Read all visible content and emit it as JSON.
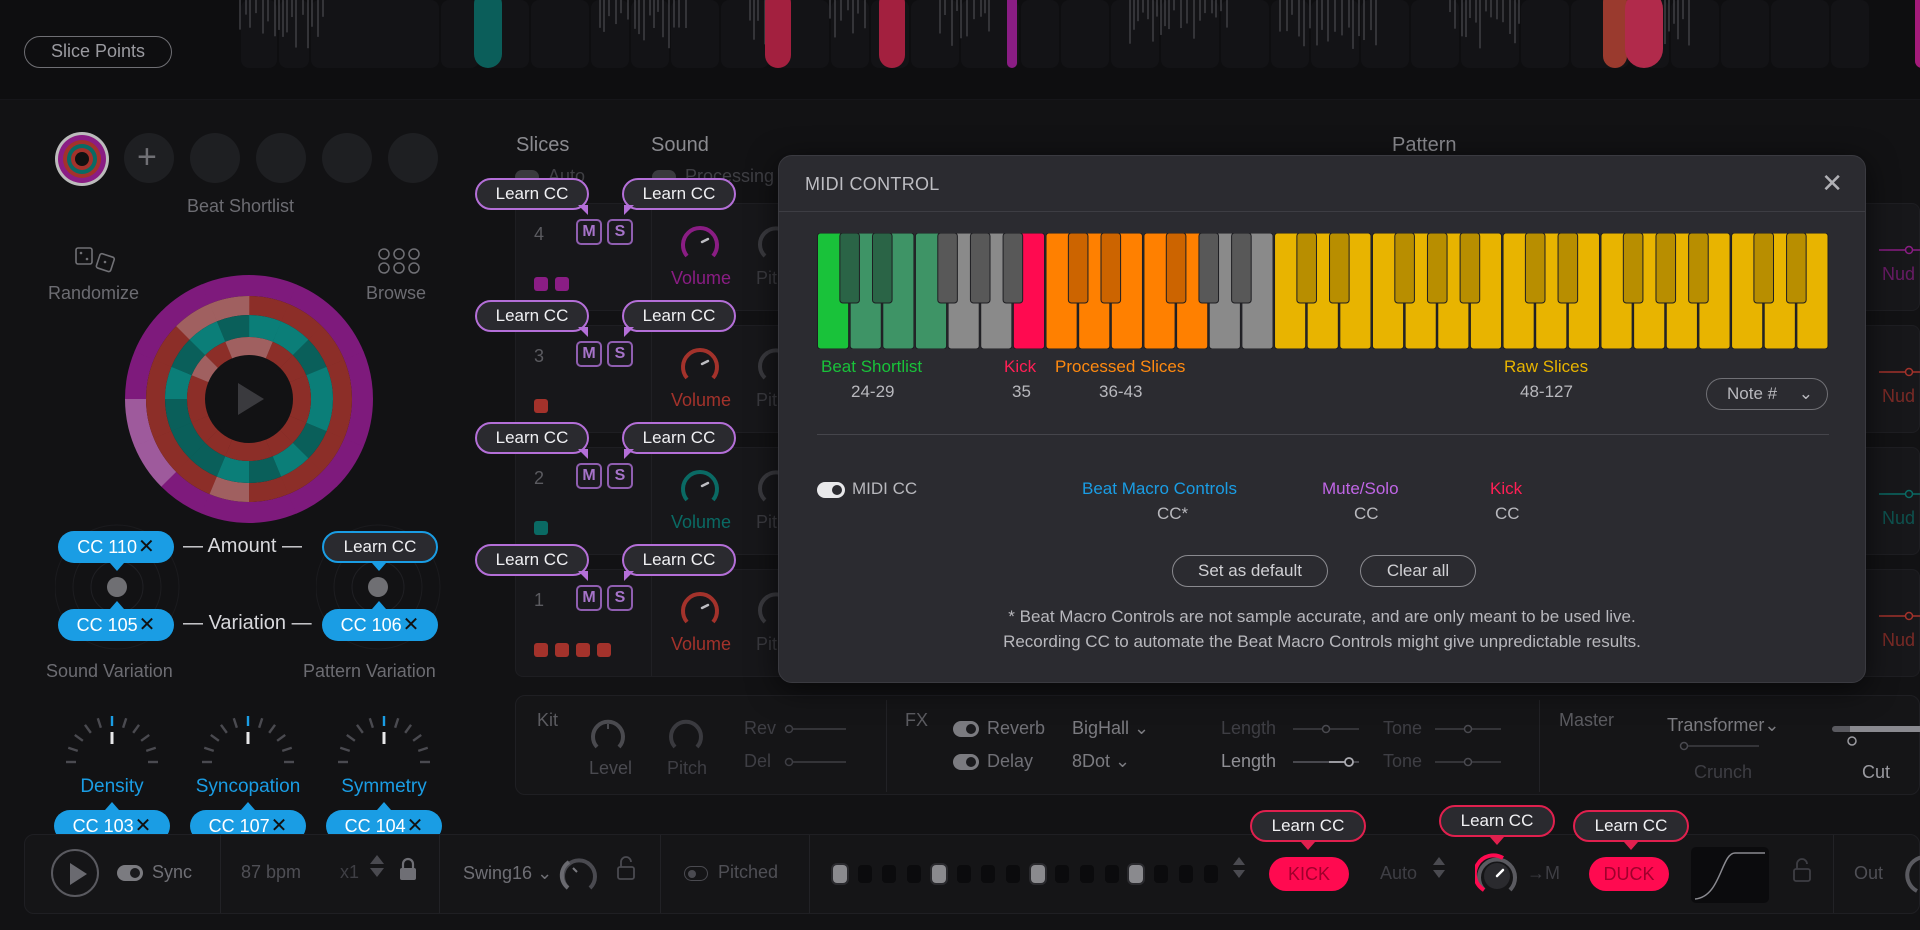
{
  "top": {
    "slice_points_label": "Slice Points",
    "slice_markers": [
      {
        "color": "#0b5e5a"
      },
      {
        "color": "#a3203f"
      },
      {
        "color": "#a3203f"
      },
      {
        "color": "#8a1d84"
      },
      {
        "color": "#9a3a2e"
      },
      {
        "color": "#b12a4b"
      },
      {
        "color": "#a41b7a"
      }
    ]
  },
  "left": {
    "beat_shortlist_label": "Beat Shortlist",
    "add_icon": "plus-icon",
    "randomize_label": "Randomize",
    "browse_label": "Browse",
    "amount_label": "Amount",
    "variation_label": "Variation",
    "sound_variation_label": "Sound Variation",
    "pattern_variation_label": "Pattern Variation",
    "cc_amount_sound": "CC 110",
    "cc_amount_pattern": "Learn CC",
    "cc_variation_sound": "CC 105",
    "cc_variation_pattern": "CC 106",
    "remove_glyph": "✕",
    "knobs": [
      {
        "label": "Density",
        "cc": "CC 103"
      },
      {
        "label": "Syncopation",
        "cc": "CC 107"
      },
      {
        "label": "Symmetry",
        "cc": "CC 104"
      }
    ]
  },
  "tracks": {
    "slices_header": "Slices",
    "sound_header": "Sound",
    "pattern_header": "Pattern",
    "auto_label": "Auto",
    "processing_label": "Processing",
    "learn_label": "Learn CC",
    "mute_label": "M",
    "solo_label": "S",
    "volume_label": "Volume",
    "pitch_label": "Pit",
    "nudge_label": "Nud",
    "rows": [
      {
        "num": "4",
        "color": "#8a1d84",
        "squares": 2
      },
      {
        "num": "3",
        "color": "#a3322b",
        "squares": 1
      },
      {
        "num": "2",
        "color": "#0a6a64",
        "squares": 1
      },
      {
        "num": "1",
        "color": "#a3322b",
        "squares": 4
      }
    ]
  },
  "modal": {
    "title": "MIDI CONTROL",
    "close_icon": "close-icon",
    "zones": [
      {
        "label": "Beat Shortlist",
        "range": "24-29",
        "color": "#19c23a"
      },
      {
        "label": "Kick",
        "range": "35",
        "color": "#ff1f55"
      },
      {
        "label": "Processed Slices",
        "range": "36-43",
        "color": "#ff8a10"
      },
      {
        "label": "Raw Slices",
        "range": "48-127",
        "color": "#e8b400"
      }
    ],
    "note_select": "Note #",
    "midi_cc_label": "MIDI CC",
    "midi_cc_enabled": true,
    "cc_groups": [
      {
        "label": "Beat Macro Controls",
        "value": "CC*",
        "color": "#1a9de4"
      },
      {
        "label": "Mute/Solo",
        "value": "CC",
        "color": "#c066e6"
      },
      {
        "label": "Kick",
        "value": "CC",
        "color": "#ff1f55"
      }
    ],
    "set_default_label": "Set as default",
    "clear_all_label": "Clear all",
    "footnote_1": "* Beat Macro Controls are not sample accurate, and are only meant to be used live.",
    "footnote_2": "Recording CC to automate the Beat Macro Controls might give unpredictable results."
  },
  "kit": {
    "label": "Kit",
    "level_label": "Level",
    "pitch_label": "Pitch",
    "rev_label": "Rev",
    "del_label": "Del"
  },
  "fx": {
    "label": "FX",
    "reverb_label": "Reverb",
    "reverb_type": "BigHall",
    "delay_label": "Delay",
    "delay_type": "8Dot",
    "length_label": "Length",
    "tone_label": "Tone"
  },
  "master": {
    "label": "Master",
    "type": "Transformer",
    "crunch_label": "Crunch",
    "cut_label": "Cut"
  },
  "transport": {
    "sync_label": "Sync",
    "bpm": "87 bpm",
    "multiplier": "x1",
    "swing": "Swing16",
    "pitched_label": "Pitched",
    "steps": [
      true,
      false,
      false,
      false,
      true,
      false,
      false,
      false,
      true,
      false,
      false,
      false,
      true,
      false,
      false,
      false
    ],
    "kick_label": "KICK",
    "auto_label": "Auto",
    "to_m_label": "→M",
    "duck_label": "DUCK",
    "out_label": "Out",
    "learn_label": "Learn CC"
  }
}
